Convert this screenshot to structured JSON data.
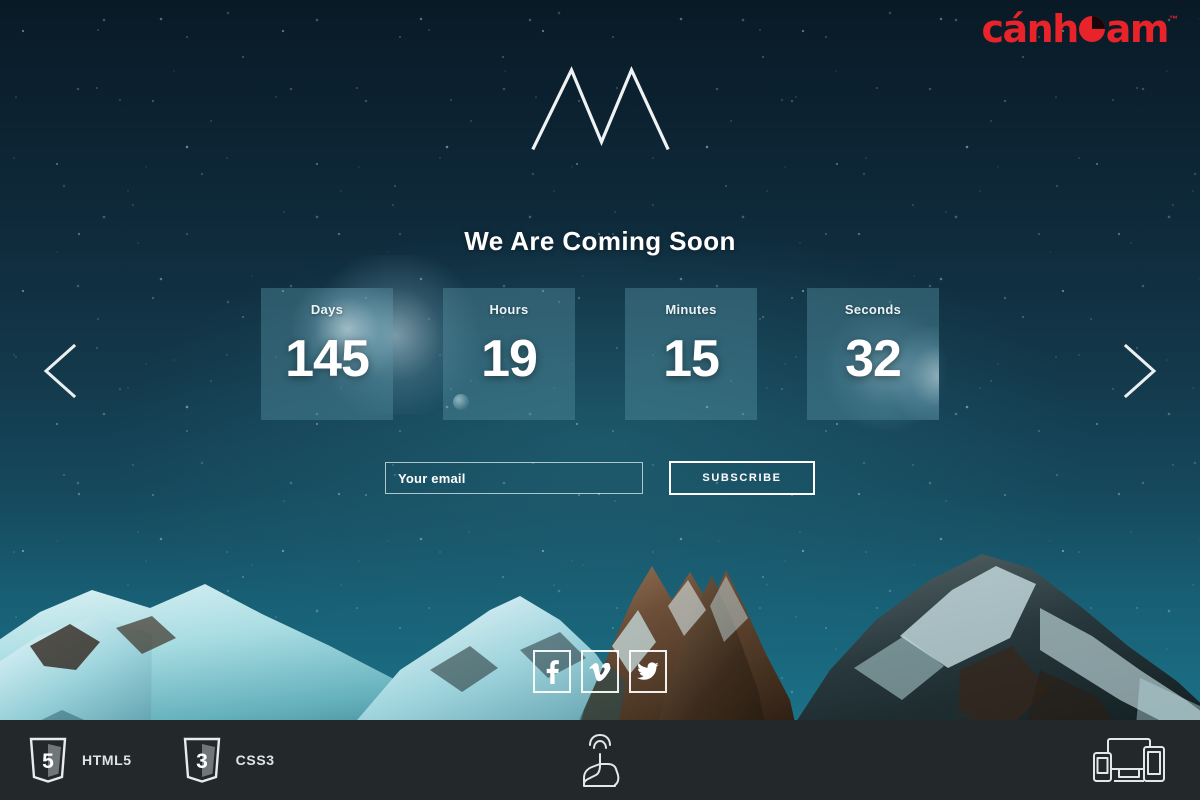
{
  "brand": {
    "name_part1": "cánh",
    "mark_icon": "orange-slice-icon",
    "name_part2": "am",
    "trademark": "™",
    "color": "#e8232a"
  },
  "hero": {
    "logo_icon": "mountain-peaks-logo",
    "headline": "We Are Coming Soon",
    "prev_arrow_icon": "chevron-left-icon",
    "next_arrow_icon": "chevron-right-icon",
    "sky_color": "#0f2c3d",
    "accent_color": "#5692a1"
  },
  "countdown": {
    "units": [
      {
        "label": "Days",
        "value": "145"
      },
      {
        "label": "Hours",
        "value": "19"
      },
      {
        "label": "Minutes",
        "value": "15"
      },
      {
        "label": "Seconds",
        "value": "32"
      }
    ]
  },
  "subscribe": {
    "email_placeholder": "Your email",
    "email_value": "",
    "button_label": "SUBSCRIBE"
  },
  "social": [
    {
      "name": "facebook",
      "icon": "facebook-icon",
      "glyph": "f"
    },
    {
      "name": "vimeo",
      "icon": "vimeo-icon",
      "glyph": "v"
    },
    {
      "name": "twitter",
      "icon": "twitter-icon",
      "glyph": "t"
    }
  ],
  "bottom_bar": {
    "background": "#23282a",
    "items": [
      {
        "icon": "html5-shield-icon",
        "label": "HTML5",
        "digit": "5"
      },
      {
        "icon": "css3-shield-icon",
        "label": "CSS3",
        "digit": "3"
      }
    ],
    "center_icon": "touch-gesture-icon",
    "right_icon": "responsive-devices-icon"
  }
}
